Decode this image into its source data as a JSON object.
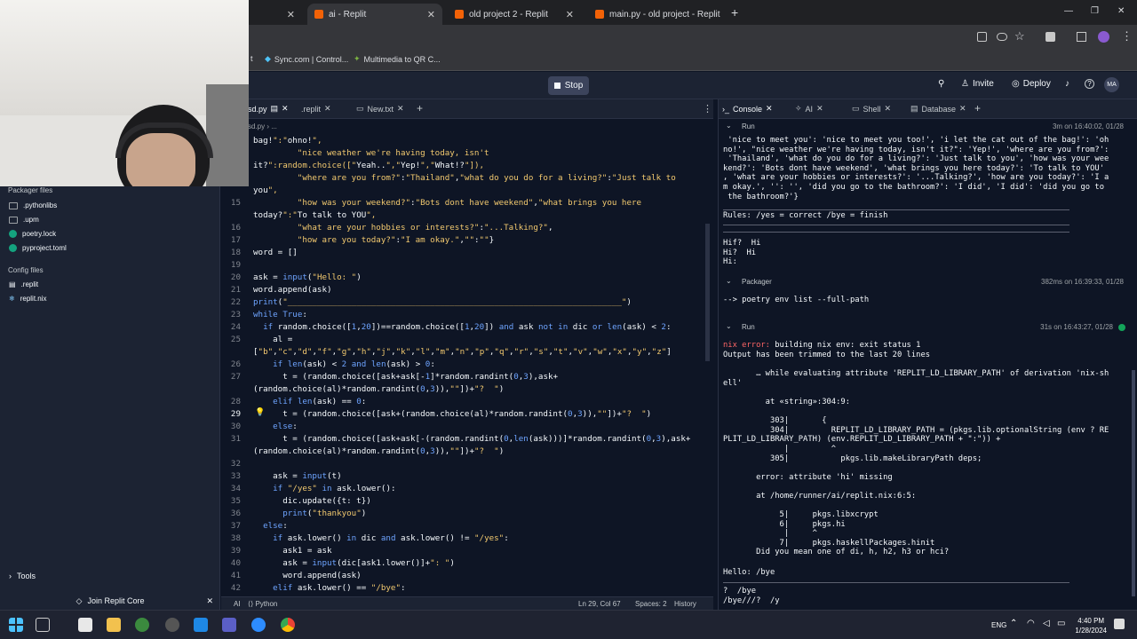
{
  "browser": {
    "tabs": [
      {
        "label": "ai - Replit",
        "active": true
      },
      {
        "label": "old project 2 - Replit",
        "active": false
      },
      {
        "label": "main.py - old project - Replit",
        "active": false
      }
    ],
    "new_tab": "+",
    "close_glyph": "✕",
    "window_controls": {
      "minimize": "—",
      "restore": "❐",
      "close": "✕"
    },
    "bookmarks": [
      {
        "label": "t"
      },
      {
        "label": "Sync.com | Control..."
      },
      {
        "label": "Multimedia to QR C..."
      }
    ]
  },
  "topbar": {
    "stop_label": "Stop",
    "invite_label": "Invite",
    "deploy_label": "Deploy",
    "help_label": "?",
    "avatar_label": "MA"
  },
  "sidebar": {
    "packager_heading": "Packager files",
    "packager_items": [
      ".pythonlibs",
      ".upm",
      "poetry.lock",
      "pyproject.toml"
    ],
    "config_heading": "Config files",
    "config_items": [
      ".replit",
      "replit.nix"
    ],
    "tools_label": "Tools",
    "join_label": "Join Replit Core"
  },
  "editor": {
    "tabs": [
      {
        "label": "sd.py"
      },
      {
        "label": ".replit"
      },
      {
        "label": "New.txt"
      }
    ],
    "add_tab": "+",
    "more": "⋮",
    "breadcrumb": "sd.py  ›  ...",
    "lines": [
      {
        "num": "",
        "text": "bag!\":\"ohno!\","
      },
      {
        "num": "",
        "text": "         \"nice weather we're having today, isn't"
      },
      {
        "num": "",
        "text": "it?\":random.choice([\"Yeah..\",\"Yep!\",\"What!?\"]),"
      },
      {
        "num": "",
        "text": "         \"where are you from?\":\"Thailand\",\"what do you do for a living?\":\"Just talk to"
      },
      {
        "num": "",
        "text": "you\","
      },
      {
        "num": "15",
        "text": "         \"how was your weekend?\":\"Bots dont have weekend\",\"what brings you here"
      },
      {
        "num": "",
        "text": "today?\":\"To talk to YOU\","
      },
      {
        "num": "16",
        "text": "         \"what are your hobbies or interests?\":\"...Talking?\","
      },
      {
        "num": "17",
        "text": "         \"how are you today?\":\"I am okay.\",\"\":\"\"}"
      },
      {
        "num": "18",
        "text": "word = []"
      },
      {
        "num": "19",
        "text": ""
      },
      {
        "num": "20",
        "text": "ask = input(\"Hello: \")"
      },
      {
        "num": "21",
        "text": "word.append(ask)"
      },
      {
        "num": "22",
        "text": "print(\"____________________________________________________________________\")"
      },
      {
        "num": "23",
        "text": "while True:"
      },
      {
        "num": "24",
        "text": "  if random.choice([1,20])==random.choice([1,20]) and ask not in dic or len(ask) < 2:"
      },
      {
        "num": "25",
        "text": "    al ="
      },
      {
        "num": "",
        "text": "[\"b\",\"c\",\"d\",\"f\",\"g\",\"h\",\"j\",\"k\",\"l\",\"m\",\"n\",\"p\",\"q\",\"r\",\"s\",\"t\",\"v\",\"w\",\"x\",\"y\",\"z\"]"
      },
      {
        "num": "26",
        "text": "    if len(ask) < 2 and len(ask) > 0:"
      },
      {
        "num": "27",
        "text": "      t = (random.choice([ask+ask[-1]*random.randint(0,3),ask+"
      },
      {
        "num": "",
        "text": "(random.choice(al)*random.randint(0,3)),\"\"])+\"?  \")"
      },
      {
        "num": "28",
        "text": "    elif len(ask) == 0:"
      },
      {
        "num": "29",
        "text": "      t = (random.choice([ask+(random.choice(al)*random.randint(0,3)),\"\"])+\"?  \")"
      },
      {
        "num": "30",
        "text": "    else:"
      },
      {
        "num": "31",
        "text": "      t = (random.choice([ask+ask[-(random.randint(0,len(ask)))]*random.randint(0,3),ask+"
      },
      {
        "num": "",
        "text": "(random.choice(al)*random.randint(0,3)),\"\"])+\"?  \")"
      },
      {
        "num": "32",
        "text": ""
      },
      {
        "num": "33",
        "text": "    ask = input(t)"
      },
      {
        "num": "34",
        "text": "    if \"/yes\" in ask.lower():"
      },
      {
        "num": "35",
        "text": "      dic.update({t: t})"
      },
      {
        "num": "36",
        "text": "      print(\"thankyou\")"
      },
      {
        "num": "37",
        "text": "  else:"
      },
      {
        "num": "38",
        "text": "    if ask.lower() in dic and ask.lower() != \"/yes\":"
      },
      {
        "num": "39",
        "text": "      ask1 = ask"
      },
      {
        "num": "40",
        "text": "      ask = input(dic[ask1.lower()]+\": \")"
      },
      {
        "num": "41",
        "text": "      word.append(ask)"
      },
      {
        "num": "42",
        "text": "    elif ask.lower() == \"/bye\":"
      },
      {
        "num": "43",
        "text": ""
      }
    ],
    "status": {
      "ai": "AI",
      "lang": "Python",
      "position": "Ln 29, Col 67",
      "spaces": "Spaces: 2",
      "history": "History"
    }
  },
  "console": {
    "tabs": [
      {
        "label": "Console"
      },
      {
        "label": "AI"
      },
      {
        "label": "Shell"
      },
      {
        "label": "Database"
      }
    ],
    "add_tab": "+",
    "runs": [
      {
        "label": "Run",
        "meta": "3m on 16:40:02, 01/28",
        "output": [
          " 'nice to meet you': 'nice to meet you too!', 'i let the cat out of the bag!': 'oh",
          "no!', \"nice weather we're having today, isn't it?\": 'Yep!', 'where are you from?':",
          " 'Thailand', 'what do you do for a living?': 'Just talk to you', 'how was your wee",
          "kend?': 'Bots dont have weekend', 'what brings you here today?': 'To talk to YOU'",
          ", 'what are your hobbies or interests?': '...Talking?', 'how are you today?': 'I a",
          "m okay.', '': '', 'did you go to the bathroom?': 'I did', 'I did': 'did you go to",
          " the bathroom?'}"
        ],
        "rules": "Rules: /yes = correct /bye = finish",
        "after": [
          "Hif?  Hi",
          "Hi?  Hi",
          "Hi:"
        ]
      },
      {
        "label": "Packager",
        "meta": "382ms on 16:39:33, 01/28",
        "output": [
          "--> poetry env list --full-path"
        ]
      },
      {
        "label": "Run",
        "meta": "31s on 16:43:27, 01/28",
        "error_prefix": "nix error:",
        "error_rest": " building nix env: exit status 1",
        "output": [
          "Output has been trimmed to the last 20 lines",
          "",
          "       … while evaluating attribute 'REPLIT_LD_LIBRARY_PATH' of derivation 'nix-sh",
          "ell'",
          "",
          "         at «string»:304:9:",
          "",
          "          303|       {",
          "          304|         REPLIT_LD_LIBRARY_PATH = (pkgs.lib.optionalString (env ? RE",
          "PLIT_LD_LIBRARY_PATH) (env.REPLIT_LD_LIBRARY_PATH + \":\")) +",
          "             |         ^",
          "          305|           pkgs.lib.makeLibraryPath deps;",
          "",
          "       error: attribute 'hi' missing",
          "",
          "       at /home/runner/ai/replit.nix:6:5:",
          "",
          "            5|     pkgs.libxcrypt",
          "            6|     pkgs.hi",
          "             |     ^",
          "            7|     pkgs.haskellPackages.hinit",
          "       Did you mean one of di, h, h2, h3 or hci?"
        ],
        "after": [
          "Hello: /bye"
        ],
        "tail": [
          "?  /bye",
          "/bye///?  /y"
        ]
      }
    ]
  },
  "taskbar": {
    "time": "4:40 PM",
    "date": "1/28/2024",
    "lang": "ENG"
  },
  "colors": {
    "bg": "#0e1525",
    "panel": "#1c2333",
    "accent": "#0079f2",
    "error": "#ff6666",
    "string": "#f2c96f",
    "keyword": "#6ea4ff"
  }
}
